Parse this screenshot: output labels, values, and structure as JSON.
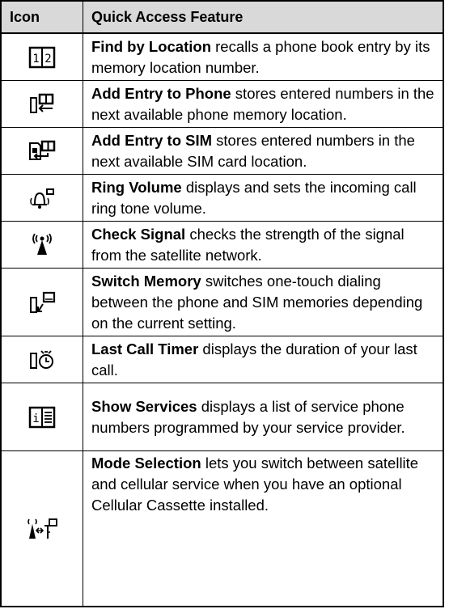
{
  "header": {
    "icon_col": "Icon",
    "feature_col": "Quick Access Feature"
  },
  "rows": [
    {
      "icon": "phonebook-12-icon",
      "name": "Find by Location",
      "desc": " recalls a phone book entry by its memory location number."
    },
    {
      "icon": "add-entry-phone-icon",
      "name": "Add Entry to Phone",
      "desc": " stores entered numbers in the next available phone memory location."
    },
    {
      "icon": "add-entry-sim-icon",
      "name": "Add Entry to SIM",
      "desc": " stores entered numbers in the next available SIM card location."
    },
    {
      "icon": "ring-volume-icon",
      "name": "Ring Volume",
      "desc": " displays and sets the incoming call ring tone volume."
    },
    {
      "icon": "check-signal-icon",
      "name": "Check Signal",
      "desc": " checks the strength of the signal from the satellite network."
    },
    {
      "icon": "switch-memory-icon",
      "name": "Switch Memory",
      "desc": " switches one-touch dialing between the phone and SIM memories depending on the current setting."
    },
    {
      "icon": "last-call-timer-icon",
      "name": "Last Call Timer",
      "desc": " displays the duration of your last call."
    },
    {
      "icon": "show-services-icon",
      "name": "Show Services",
      "desc": " displays a list of service phone numbers programmed by your service provider."
    },
    {
      "icon": "mode-selection-icon",
      "name": "Mode Selection",
      "desc": " lets you switch between satellite and cellular service when you have an optional Cellular Cassette installed."
    }
  ]
}
